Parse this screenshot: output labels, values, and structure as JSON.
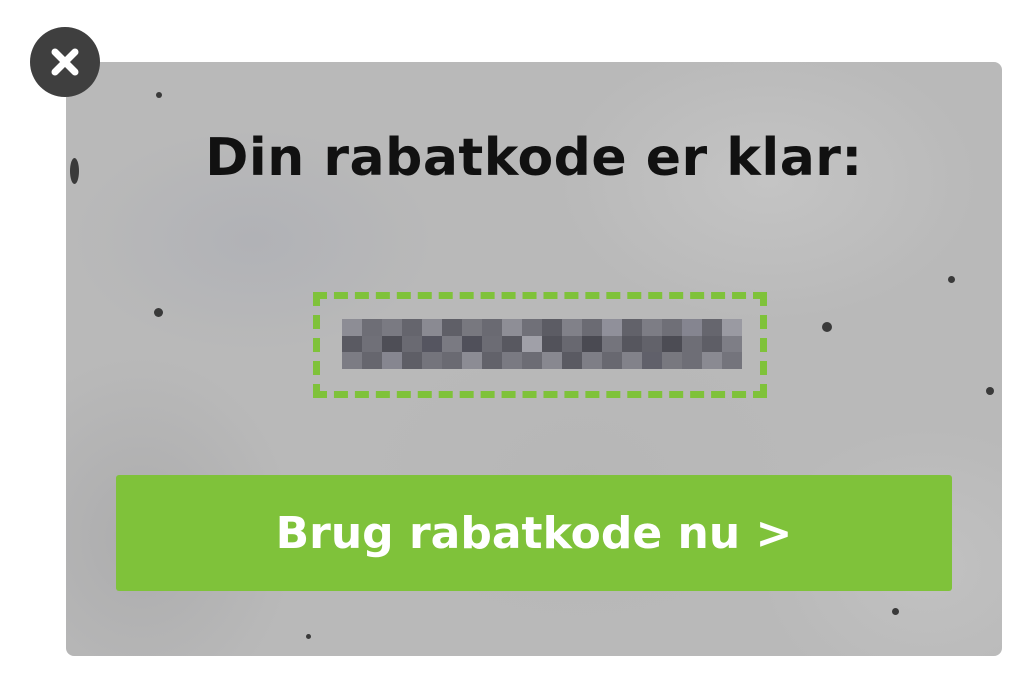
{
  "popup": {
    "headline": "Din rabatkode er klar:",
    "code_value": "",
    "code_state": "pixelated / obscured",
    "cta_label": "Brug rabatkode nu >",
    "close_icon": "close-icon"
  },
  "colors": {
    "accent_green": "#7fc23a",
    "concrete_bg": "#b9b9b9",
    "headline_text": "#111111",
    "cta_text": "#ffffff",
    "close_bg": "#3f3f3f"
  }
}
